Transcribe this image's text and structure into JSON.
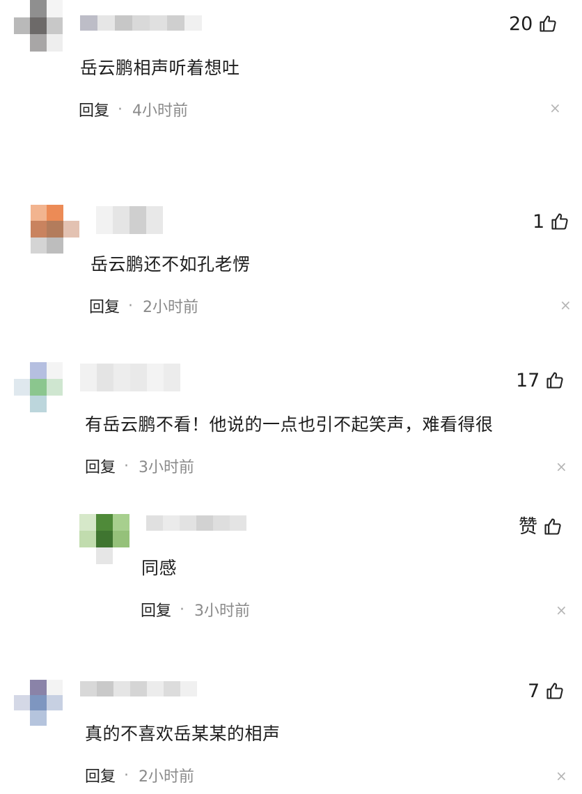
{
  "comments": [
    {
      "likes": "20",
      "text": "岳云鹏相声听着想吐",
      "reply_label": "回复",
      "time": "4小时前"
    },
    {
      "likes": "1",
      "text": "岳云鹏还不如孔老愣",
      "reply_label": "回复",
      "time": "2小时前"
    },
    {
      "likes": "17",
      "text": "有岳云鹏不看！他说的一点也引不起笑声，难看得很",
      "reply_label": "回复",
      "time": "3小时前",
      "replies": [
        {
          "likes": "赞",
          "text": "同感",
          "reply_label": "回复",
          "time": "3小时前"
        }
      ]
    },
    {
      "likes": "7",
      "text": "真的不喜欢岳某某的相声",
      "reply_label": "回复",
      "time": "2小时前"
    }
  ],
  "meta_separator": "·",
  "close_glyph": "×",
  "icons": {
    "like": "thumbs-up-icon",
    "close": "close-icon"
  }
}
